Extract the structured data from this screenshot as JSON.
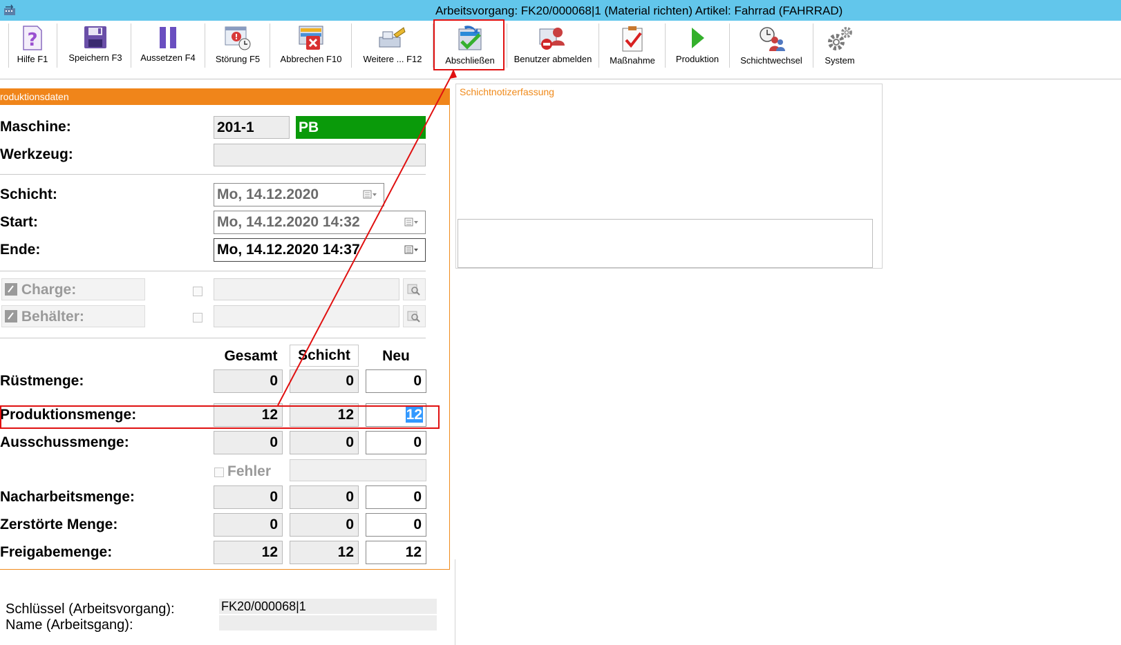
{
  "window": {
    "title": "Arbeitsvorgang: FK20/000068|1 (Material richten)  Artikel: Fahrrad (FAHRRAD)"
  },
  "toolbar": {
    "buttons": [
      {
        "label": "Hilfe F1",
        "icon": "help-icon"
      },
      {
        "label": "Speichern F3",
        "icon": "save-icon"
      },
      {
        "label": "Aussetzen F4",
        "icon": "pause-icon"
      },
      {
        "label": "Störung F5",
        "icon": "malfunction-icon"
      },
      {
        "label": "Abbrechen F10",
        "icon": "cancel-icon"
      },
      {
        "label": "Weitere ... F12",
        "icon": "more-icon"
      },
      {
        "label": "Abschließen",
        "icon": "complete-icon"
      },
      {
        "label": "Benutzer abmelden",
        "icon": "logout-user-icon"
      },
      {
        "label": "Maßnahme",
        "icon": "measure-icon"
      },
      {
        "label": "Produktion",
        "icon": "play-icon"
      },
      {
        "label": "Schichtwechsel",
        "icon": "shift-change-icon"
      },
      {
        "label": "System",
        "icon": "gear-icon"
      }
    ]
  },
  "production": {
    "header": "roduktionsdaten",
    "machine_label": "Maschine:",
    "machine_value": "201-1",
    "machine_status": "PB",
    "machine_status_color": "#0a9a0a",
    "tool_label": "Werkzeug:",
    "tool_value": "",
    "shift_label": "Schicht:",
    "shift_value": "Mo, 14.12.2020",
    "start_label": "Start:",
    "start_value": "Mo, 14.12.2020  14:32",
    "end_label": "Ende:",
    "end_value": "Mo, 14.12.2020  14:37",
    "charge_label": "Charge:",
    "container_label": "Behälter:",
    "col_total": "Gesamt",
    "col_shift": "Schicht",
    "col_new": "Neu",
    "rows": {
      "setup": {
        "label": "Rüstmenge:",
        "total": "0",
        "shift": "0",
        "new": "0"
      },
      "production": {
        "label": "Produktionsmenge:",
        "total": "12",
        "shift": "12",
        "new": "12"
      },
      "scrap": {
        "label": "Ausschussmenge:",
        "total": "0",
        "shift": "0",
        "new": "0"
      },
      "rework": {
        "label": "Nacharbeitsmenge:",
        "total": "0",
        "shift": "0",
        "new": "0"
      },
      "destroyed": {
        "label": "Zerstörte Menge:",
        "total": "0",
        "shift": "0",
        "new": "0"
      },
      "release": {
        "label": "Freigabemenge:",
        "total": "12",
        "shift": "12",
        "new": "12"
      }
    },
    "error_label": "Fehler",
    "error_value": ""
  },
  "shift_notes": {
    "title": "Schichtnotizerfassung",
    "text": ""
  },
  "order_info": {
    "key_label": "Schlüssel (Arbeitsvorgang):",
    "key_value": "FK20/000068|1",
    "name_label": "Name (Arbeitsgang):",
    "name_value": ""
  },
  "colors": {
    "titlebar": "#62c6eb",
    "accent": "#f0851a",
    "annotation": "#e01010"
  }
}
